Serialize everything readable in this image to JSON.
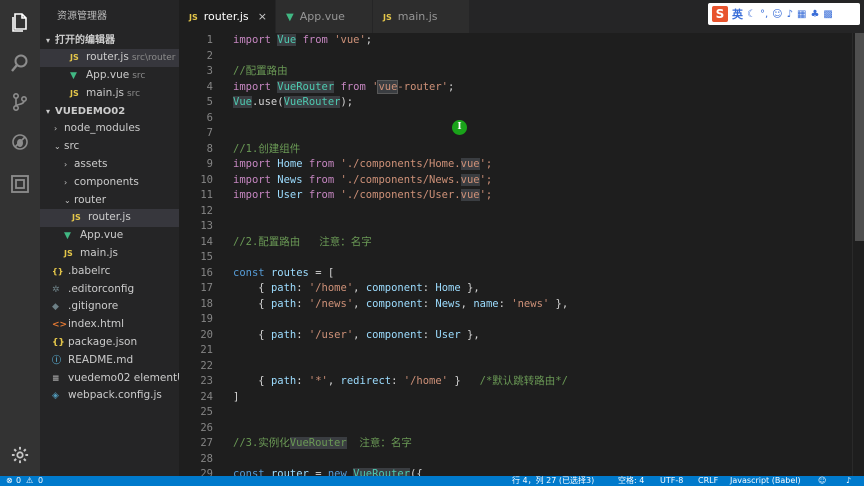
{
  "sidebar": {
    "title": "资源管理器",
    "open_editors": {
      "label": "打开的编辑器",
      "items": [
        {
          "name": "router.js",
          "desc": "src\\router",
          "icon": "js-icon"
        },
        {
          "name": "App.vue",
          "desc": "src",
          "icon": "vue-icon"
        },
        {
          "name": "main.js",
          "desc": "src",
          "icon": "js-icon"
        }
      ]
    },
    "project": {
      "label": "VUEDEMO02",
      "items": [
        {
          "name": "node_modules"
        },
        {
          "name": "src"
        },
        {
          "name": "assets"
        },
        {
          "name": "components"
        },
        {
          "name": "router"
        },
        {
          "name": "router.js"
        },
        {
          "name": "App.vue"
        },
        {
          "name": "main.js"
        },
        {
          "name": ".babelrc"
        },
        {
          "name": ".editorconfig"
        },
        {
          "name": ".gitignore"
        },
        {
          "name": "index.html"
        },
        {
          "name": "package.json"
        },
        {
          "name": "README.md"
        },
        {
          "name": "vuedemo02 elementU..."
        },
        {
          "name": "webpack.config.js"
        }
      ]
    }
  },
  "tabs": [
    {
      "label": "router.js",
      "icon": "js-icon",
      "active": true,
      "close": "×"
    },
    {
      "label": "App.vue",
      "icon": "vue-icon",
      "active": false
    },
    {
      "label": "main.js",
      "icon": "js-icon",
      "active": false
    }
  ],
  "ime": {
    "logo": "S",
    "label": "英"
  },
  "editor": {
    "lines": [
      {
        "n": "1"
      },
      {
        "n": "2"
      },
      {
        "n": "3"
      },
      {
        "n": "4"
      },
      {
        "n": "5"
      },
      {
        "n": "6"
      },
      {
        "n": "7"
      },
      {
        "n": "8"
      },
      {
        "n": "9"
      },
      {
        "n": "10"
      },
      {
        "n": "11"
      },
      {
        "n": "12"
      },
      {
        "n": "13"
      },
      {
        "n": "14"
      },
      {
        "n": "15"
      },
      {
        "n": "16"
      },
      {
        "n": "17"
      },
      {
        "n": "18"
      },
      {
        "n": "19"
      },
      {
        "n": "20"
      },
      {
        "n": "21"
      },
      {
        "n": "22"
      },
      {
        "n": "23"
      },
      {
        "n": "24"
      },
      {
        "n": "25"
      },
      {
        "n": "26"
      },
      {
        "n": "27"
      },
      {
        "n": "28"
      },
      {
        "n": "29"
      }
    ],
    "code": {
      "l1": {
        "kw": "import",
        "cls": "Vue",
        "from": "from",
        "str": "'vue'"
      },
      "l3": "//配置路由",
      "l4": {
        "kw": "import",
        "cls": "VueRouter",
        "from": "from",
        "q1": "'",
        "hl": "vue",
        "rest": "-router'"
      },
      "l5": {
        "a": "Vue",
        "b": ".use(",
        "c": "VueRouter",
        "d": ");"
      },
      "l8": "//1.创建组件",
      "l9": {
        "kw": "import",
        "cls": "Home",
        "from": "from",
        "str": "'./components/Home.",
        "hl": "vue",
        "end": "';"
      },
      "l10": {
        "kw": "import",
        "cls": "News",
        "from": "from",
        "str": "'./components/News.",
        "hl": "vue",
        "end": "';"
      },
      "l11": {
        "kw": "import",
        "cls": "User",
        "from": "from",
        "str": "'./components/User.",
        "hl": "vue",
        "end": "';"
      },
      "l14": "//2.配置路由   注意：名字",
      "l16": {
        "kw": "const",
        "vr": "routes",
        "rest": " = ["
      },
      "l17": {
        "p": "path",
        "s": "'/home'",
        "c": "component",
        "v": "Home"
      },
      "l18": {
        "p": "path",
        "s": "'/news'",
        "c": "component",
        "v": "News",
        "n": "name",
        "ns": "'news'"
      },
      "l20": {
        "p": "path",
        "s": "'/user'",
        "c": "component",
        "v": "User"
      },
      "l23": {
        "p": "path",
        "s": "'*'",
        "r": "redirect",
        "rs": "'/home'",
        "cm": "/*默认跳转路由*/"
      },
      "l24": "]",
      "l27": {
        "a": "//3.实例化",
        "hl": "VueRouter",
        "b": "  注意：名字"
      },
      "l29": {
        "kw": "const",
        "vr": "router",
        "nw": "new",
        "hl": "VueRouter",
        "rest": "({"
      }
    }
  },
  "statusbar": {
    "errors": "0",
    "warnings": "0",
    "position": "行 4，列 27 (已选择3)",
    "spaces": "空格: 4",
    "encoding": "UTF-8",
    "eol": "CRLF",
    "language": "Javascript (Babel)"
  }
}
